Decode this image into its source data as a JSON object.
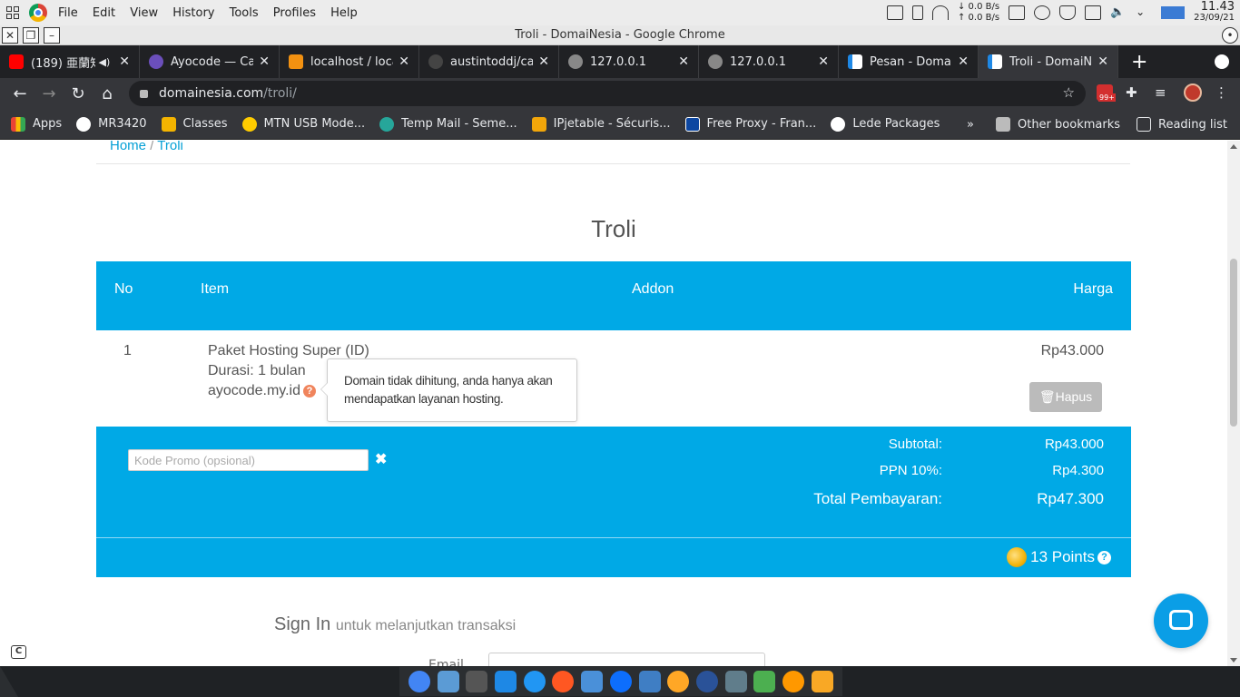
{
  "os": {
    "menu": [
      "File",
      "Edit",
      "View",
      "History",
      "Tools",
      "Profiles",
      "Help"
    ],
    "net_down": "0.0 B/s",
    "net_up": "0.0 B/s",
    "time": "11.43",
    "date": "23/09/21"
  },
  "window": {
    "title": "Troli - DomaiNesia - Google Chrome"
  },
  "tabs": [
    {
      "title": "(189) 亜蘭知",
      "color": "#ff0000"
    },
    {
      "title": "Ayocode — Ca",
      "color": "#6b4fbb"
    },
    {
      "title": "localhost / loca",
      "color": "#f29111"
    },
    {
      "title": "austintoddj/ca",
      "color": "#444444"
    },
    {
      "title": "127.0.0.1",
      "color": "#888888"
    },
    {
      "title": "127.0.0.1",
      "color": "#888888"
    },
    {
      "title": "Pesan - Domai",
      "color": "#1e88e5"
    },
    {
      "title": "Troli - DomaiNe",
      "color": "#1e88e5"
    }
  ],
  "address": {
    "domain": "domainesia.com",
    "path": "/troli/"
  },
  "extension_badge": "99+",
  "bookmarks": [
    {
      "label": "Apps",
      "color": "#e8eaed"
    },
    {
      "label": "MR3420",
      "color": "#ffffff"
    },
    {
      "label": "Classes",
      "color": "#f4b400"
    },
    {
      "label": "MTN USB Mode...",
      "color": "#ffcc00"
    },
    {
      "label": "Temp Mail - Seme...",
      "color": "#26a69a"
    },
    {
      "label": "IPjetable - Sécuris...",
      "color": "#f2a60a"
    },
    {
      "label": "Free Proxy - Fran...",
      "color": "#0d47a1"
    },
    {
      "label": "Lede Packages",
      "color": "#ffffff"
    }
  ],
  "bookmarks_overflow": "»",
  "other_bookmarks": "Other bookmarks",
  "reading_list": "Reading list",
  "breadcrumb": {
    "home": "Home",
    "sep": "/",
    "current": "Troli"
  },
  "page_title": "Troli",
  "cart": {
    "headers": {
      "no": "No",
      "item": "Item",
      "addon": "Addon",
      "price": "Harga"
    },
    "row": {
      "no": "1",
      "name": "Paket Hosting Super (ID)",
      "duration": "Durasi: 1 bulan",
      "domain": "ayocode.my.id",
      "price": "Rp43.000",
      "delete_label": "Hapus"
    },
    "tooltip": "Domain tidak dihitung, anda hanya akan mendapatkan layanan hosting.",
    "promo_placeholder": "Kode Promo (opsional)",
    "subtotal_label": "Subtotal:",
    "subtotal": "Rp43.000",
    "tax_label": "PPN 10%:",
    "tax": "Rp4.300",
    "total_label": "Total Pembayaran:",
    "total": "Rp47.300",
    "points": "13  Points"
  },
  "signin": {
    "title": "Sign In",
    "subtitle": "untuk melanjutkan transaksi",
    "email_label": "Email"
  },
  "colors": {
    "accent": "#00a9e6",
    "link": "#06a0d6"
  },
  "dock_icons": [
    "#4285f4",
    "#5b9bd5",
    "#555555",
    "#1e88e5",
    "#2196f3",
    "#ff5722",
    "#4a90d9",
    "#0d6efd",
    "#3f7ec4",
    "#ffa726",
    "#2a5298",
    "#607d8b",
    "#4caf50",
    "#ff9800",
    "#f9a825"
  ]
}
